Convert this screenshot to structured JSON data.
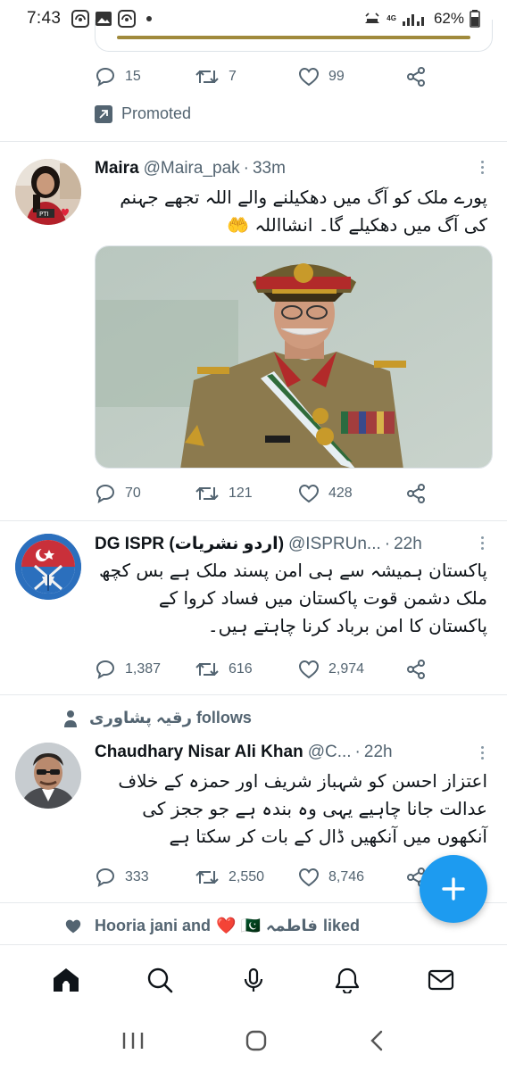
{
  "status_bar": {
    "time": "7:43",
    "network": "4G",
    "battery": "62%"
  },
  "promo_tweet": {
    "replies": "15",
    "retweets": "7",
    "likes": "99",
    "promoted_label": "Promoted"
  },
  "tweets": [
    {
      "name": "Maira",
      "handle": "@Maira_pak",
      "time": "33m",
      "text": "پورے ملک کو آگ میں دھکیلنے والے اللہ تجھے جہنم کی آگ میں دھکیلے گا۔ انشااللہ 🤲",
      "replies": "70",
      "retweets": "121",
      "likes": "428",
      "avatar_badge": "PTI"
    },
    {
      "name": "DG ISPR (اردو نشریات)",
      "handle": "@ISPRUn...",
      "time": "22h",
      "text": "پاکستان ہمیشہ سے ہی امن پسند ملک ہے بس کچھ ملک دشمن قوت پاکستان میں فساد کروا کے پاکستان کا امن برباد کرنا چاہتے ہیں۔",
      "replies": "1,387",
      "retweets": "616",
      "likes": "2,974"
    },
    {
      "context": "رقیہ پشاوری follows",
      "name": "Chaudhary Nisar Ali Khan",
      "handle": "@C...",
      "time": "22h",
      "text": "اعتزاز احسن کو شہباز شریف اور حمزہ کے خلاف عدالت جانا چاہیے یہی وہ بندہ ہے جو ججز کی آنکھوں میں آنکھیں ڈال کے بات کر سکتا ہے",
      "replies": "333",
      "retweets": "2,550",
      "likes": "8,746"
    }
  ],
  "liked_context": {
    "text": "Hooria jani and",
    "emojis": "❤️ 🇵🇰",
    "name2": "فاطمہ",
    "suffix": "liked"
  },
  "icons": {
    "reply": "reply-icon",
    "retweet": "retweet-icon",
    "like": "heart-icon",
    "share": "share-icon",
    "compose": "plus-icon"
  },
  "colors": {
    "accent": "#1d9bf0",
    "secondary_text": "#536471",
    "divider": "#e6e9ec"
  }
}
